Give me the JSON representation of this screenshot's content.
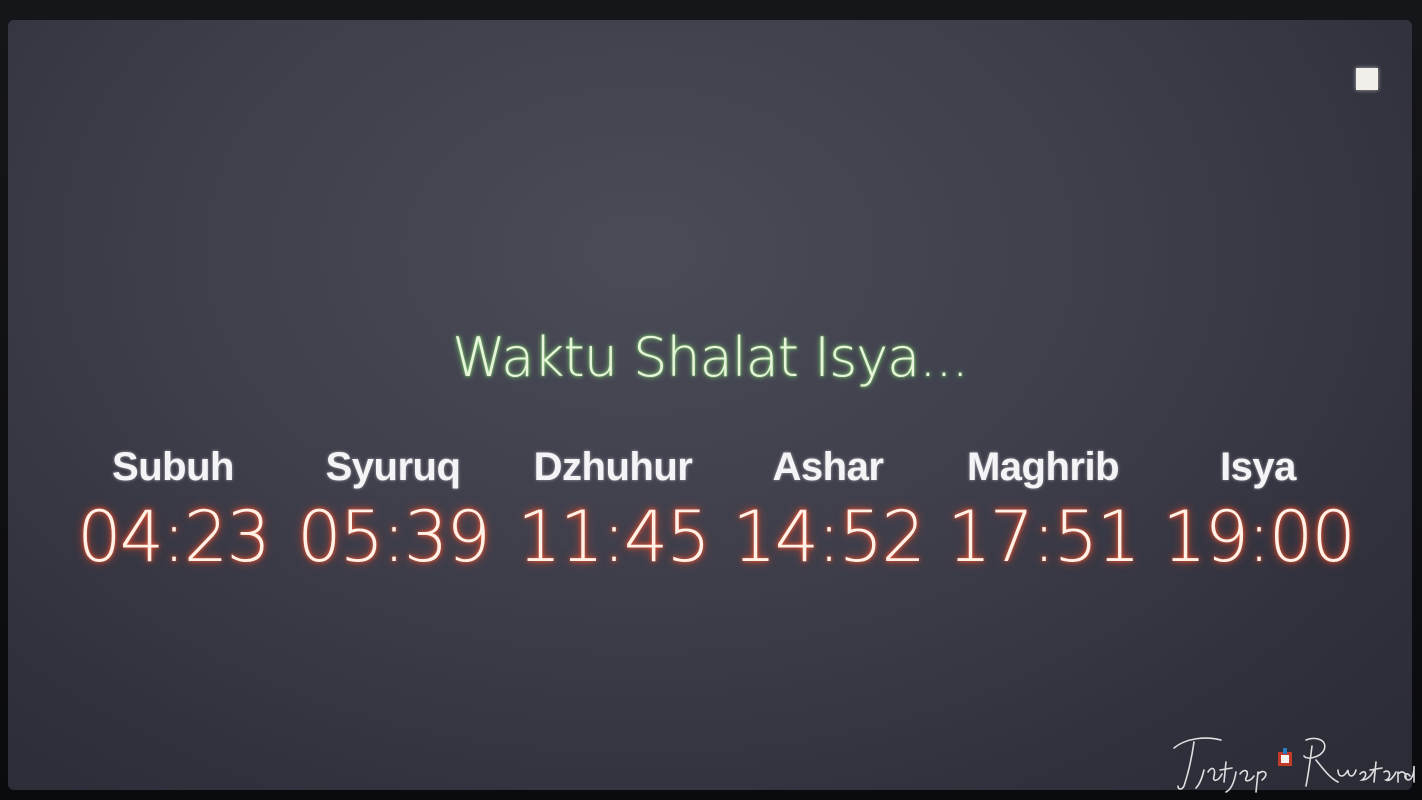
{
  "headline": "Waktu Shalat Isya...",
  "prayers": [
    {
      "name": "Subuh",
      "time": "04:23"
    },
    {
      "name": "Syuruq",
      "time": "05:39"
    },
    {
      "name": "Dzhuhur",
      "time": "11:45"
    },
    {
      "name": "Ashar",
      "time": "14:52"
    },
    {
      "name": "Maghrib",
      "time": "17:51"
    },
    {
      "name": "Isya",
      "time": "19:00"
    }
  ],
  "watermark": "Tjetjep Rustandi",
  "colors": {
    "headline": "#e8f5dc",
    "headline_glow": "#8cdc78",
    "time_glow": "#ff5a32",
    "name": "#f4f4f6",
    "screen": "#3d3e4a"
  }
}
